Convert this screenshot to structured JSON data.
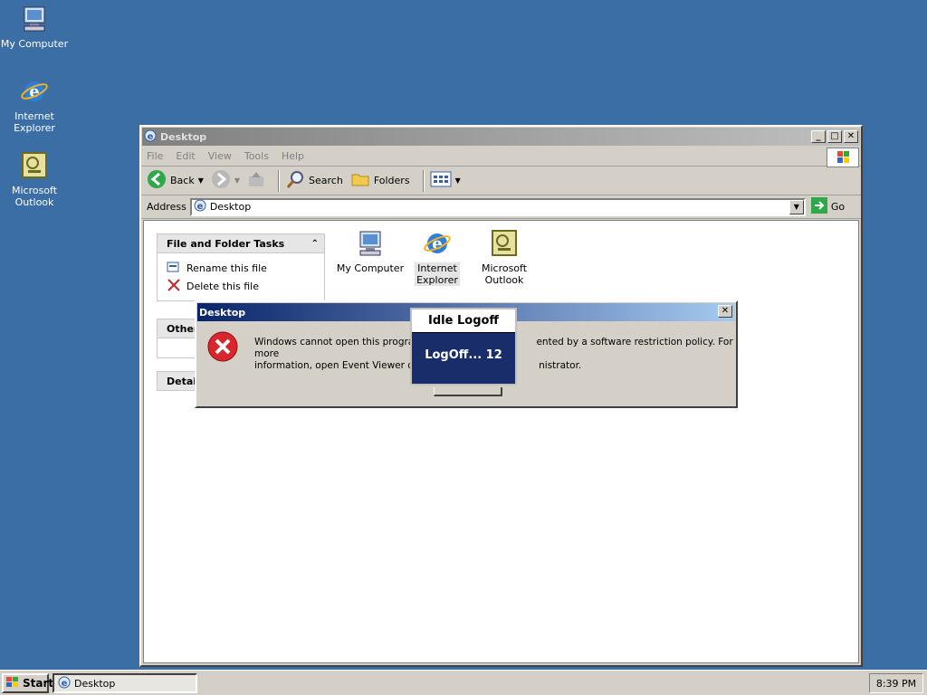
{
  "desktop": {
    "icons": [
      {
        "label_line1": "My Computer",
        "label_line2": "",
        "icon": "my-computer-icon"
      },
      {
        "label_line1": "Internet",
        "label_line2": "Explorer",
        "icon": "ie-icon"
      },
      {
        "label_line1": "Microsoft",
        "label_line2": "Outlook",
        "icon": "outlook-icon"
      }
    ]
  },
  "window": {
    "title": "Desktop",
    "menu": [
      "File",
      "Edit",
      "View",
      "Tools",
      "Help"
    ],
    "toolbar": {
      "back": "Back",
      "search": "Search",
      "folders": "Folders"
    },
    "address": {
      "label": "Address",
      "value": "Desktop",
      "go": "Go"
    },
    "panels": {
      "file_tasks": {
        "title": "File and Folder Tasks",
        "items": [
          "Rename this file",
          "Delete this file"
        ]
      },
      "other": {
        "title": "Other"
      },
      "details": {
        "title": "Detail"
      }
    },
    "items": [
      {
        "line1": "My Computer",
        "line2": ""
      },
      {
        "line1": "Internet",
        "line2": "Explorer"
      },
      {
        "line1": "Microsoft",
        "line2": "Outlook"
      }
    ]
  },
  "dialog": {
    "title": "Desktop",
    "message_line1": "Windows cannot open this program",
    "message_line1b": "ented by a software restriction policy. For more",
    "message_line2": "information, open Event Viewer or c",
    "message_line2b": "nistrator."
  },
  "idle": {
    "title": "Idle Logoff",
    "status": "LogOff... 12"
  },
  "taskbar": {
    "start": "Start",
    "task": "Desktop",
    "clock": "8:39 PM"
  },
  "colors": {
    "desktop": "#3a6ea5",
    "dialog_title": "#0a246a",
    "idle_bg": "#1a2d6b"
  }
}
